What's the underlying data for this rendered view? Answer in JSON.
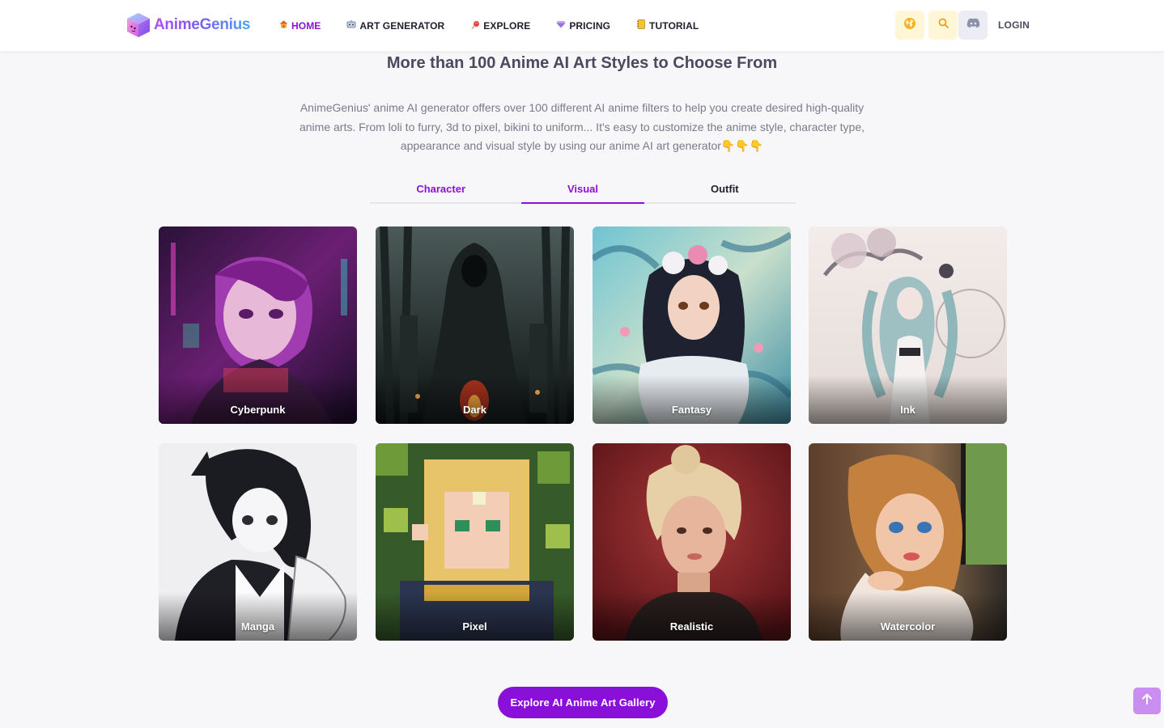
{
  "header": {
    "brand": "AnimeGenius",
    "nav": [
      {
        "label": "HOME",
        "icon": "house-icon",
        "active": true
      },
      {
        "label": "ART GENERATOR",
        "icon": "painting-robot-icon",
        "active": false
      },
      {
        "label": "EXPLORE",
        "icon": "lollipop-icon",
        "active": false
      },
      {
        "label": "PRICING",
        "icon": "gem-icon",
        "active": false
      },
      {
        "label": "TUTORIAL",
        "icon": "notebook-icon",
        "active": false
      }
    ],
    "buttons": {
      "language_icon": "globe-icon",
      "search_icon": "search-icon",
      "discord_icon": "discord-icon"
    },
    "login_label": "LOGIN"
  },
  "section": {
    "title": "More than 100 Anime AI Art Styles to Choose From",
    "description": "AnimeGenius' anime AI generator offers over 100 different AI anime filters to help you create desired high-quality anime arts. From loli to furry, 3d to pixel, bikini to uniform... It's easy to customize the anime style, character type, appearance and visual style by using our anime AI art generator👇👇👇"
  },
  "tabs": [
    {
      "label": "Character",
      "active": false
    },
    {
      "label": "Visual",
      "active": true
    },
    {
      "label": "Outfit",
      "active": false
    }
  ],
  "styles": [
    {
      "label": "Cyberpunk"
    },
    {
      "label": "Dark"
    },
    {
      "label": "Fantasy"
    },
    {
      "label": "Ink"
    },
    {
      "label": "Manga"
    },
    {
      "label": "Pixel"
    },
    {
      "label": "Realistic"
    },
    {
      "label": "Watercolor"
    }
  ],
  "cta_label": "Explore AI Anime Art Gallery",
  "back_to_top_icon": "arrow-up-icon",
  "colors": {
    "accent": "#8b11d6",
    "cta_bg": "#8a0fd8",
    "page_bg": "#f7f7f9",
    "to_top_bg": "#c98ef0"
  }
}
